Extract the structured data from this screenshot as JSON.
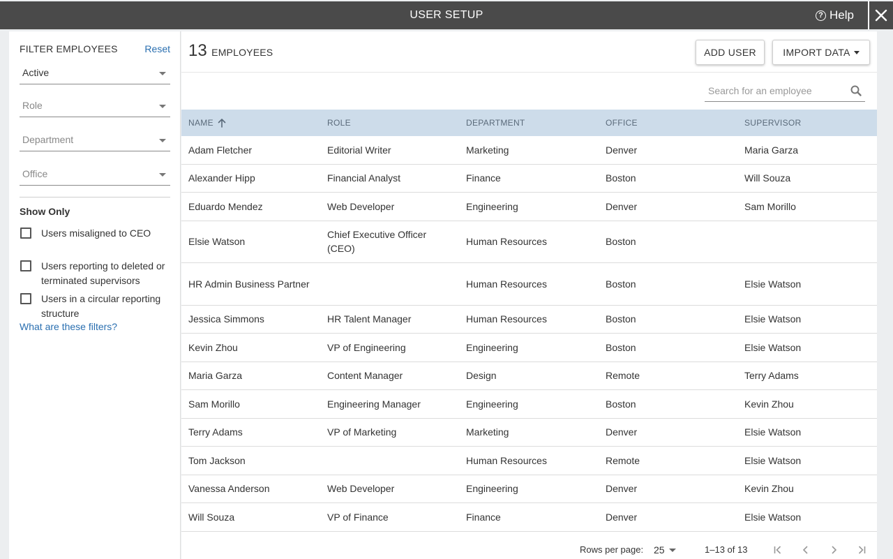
{
  "window": {
    "title": "USER SETUP",
    "help_label": "Help"
  },
  "sidebar": {
    "filter_title": "FILTER EMPLOYEES",
    "reset_label": "Reset",
    "status_filter": "Active",
    "role_placeholder": "Role",
    "department_placeholder": "Department",
    "office_placeholder": "Office",
    "show_only_label": "Show Only",
    "checkboxes": [
      {
        "label": "Users misaligned to CEO",
        "checked": false
      },
      {
        "label": "Users reporting to deleted or terminated supervisors",
        "checked": false
      },
      {
        "label": "Users in a circular reporting structure",
        "checked": false
      }
    ],
    "what_filters_link": "What are these filters?"
  },
  "main": {
    "employee_count": "13",
    "employee_count_label": "EMPLOYEES",
    "add_user_label": "ADD USER",
    "import_data_label": "IMPORT DATA",
    "search_placeholder": "Search for an employee",
    "columns": [
      "NAME",
      "ROLE",
      "DEPARTMENT",
      "OFFICE",
      "SUPERVISOR"
    ],
    "rows": [
      {
        "name": "Adam Fletcher",
        "role": "Editorial Writer",
        "department": "Marketing",
        "office": "Denver",
        "supervisor": "Maria Garza"
      },
      {
        "name": "Alexander Hipp",
        "role": "Financial Analyst",
        "department": "Finance",
        "office": "Boston",
        "supervisor": "Will Souza"
      },
      {
        "name": "Eduardo Mendez",
        "role": "Web Developer",
        "department": "Engineering",
        "office": "Denver",
        "supervisor": "Sam Morillo"
      },
      {
        "name": "Elsie Watson",
        "role": "Chief Executive Officer (CEO)",
        "department": "Human Resources",
        "office": "Boston",
        "supervisor": ""
      },
      {
        "name": "HR Admin Business Partner",
        "role": "",
        "department": "Human Resources",
        "office": "Boston",
        "supervisor": "Elsie Watson"
      },
      {
        "name": "Jessica Simmons",
        "role": "HR Talent Manager",
        "department": "Human Resources",
        "office": "Boston",
        "supervisor": "Elsie Watson"
      },
      {
        "name": "Kevin Zhou",
        "role": "VP of Engineering",
        "department": "Engineering",
        "office": "Boston",
        "supervisor": "Elsie Watson"
      },
      {
        "name": "Maria Garza",
        "role": "Content Manager",
        "department": "Design",
        "office": "Remote",
        "supervisor": "Terry Adams"
      },
      {
        "name": "Sam Morillo",
        "role": "Engineering Manager",
        "department": "Engineering",
        "office": "Boston",
        "supervisor": "Kevin Zhou"
      },
      {
        "name": "Terry Adams",
        "role": "VP of Marketing",
        "department": "Marketing",
        "office": "Denver",
        "supervisor": "Elsie Watson"
      },
      {
        "name": "Tom Jackson",
        "role": "",
        "department": "Human Resources",
        "office": "Remote",
        "supervisor": "Elsie Watson"
      },
      {
        "name": "Vanessa Anderson",
        "role": "Web Developer",
        "department": "Engineering",
        "office": "Denver",
        "supervisor": "Kevin Zhou"
      },
      {
        "name": "Will Souza",
        "role": "VP of Finance",
        "department": "Finance",
        "office": "Denver",
        "supervisor": "Elsie Watson"
      }
    ]
  },
  "pagination": {
    "rows_per_page_label": "Rows per page:",
    "rows_per_page": "25",
    "range": "1–13 of 13"
  },
  "colors": {
    "topbar": "#4a4a4a",
    "table_header": "#cddcea",
    "link": "#2a6fb0"
  }
}
